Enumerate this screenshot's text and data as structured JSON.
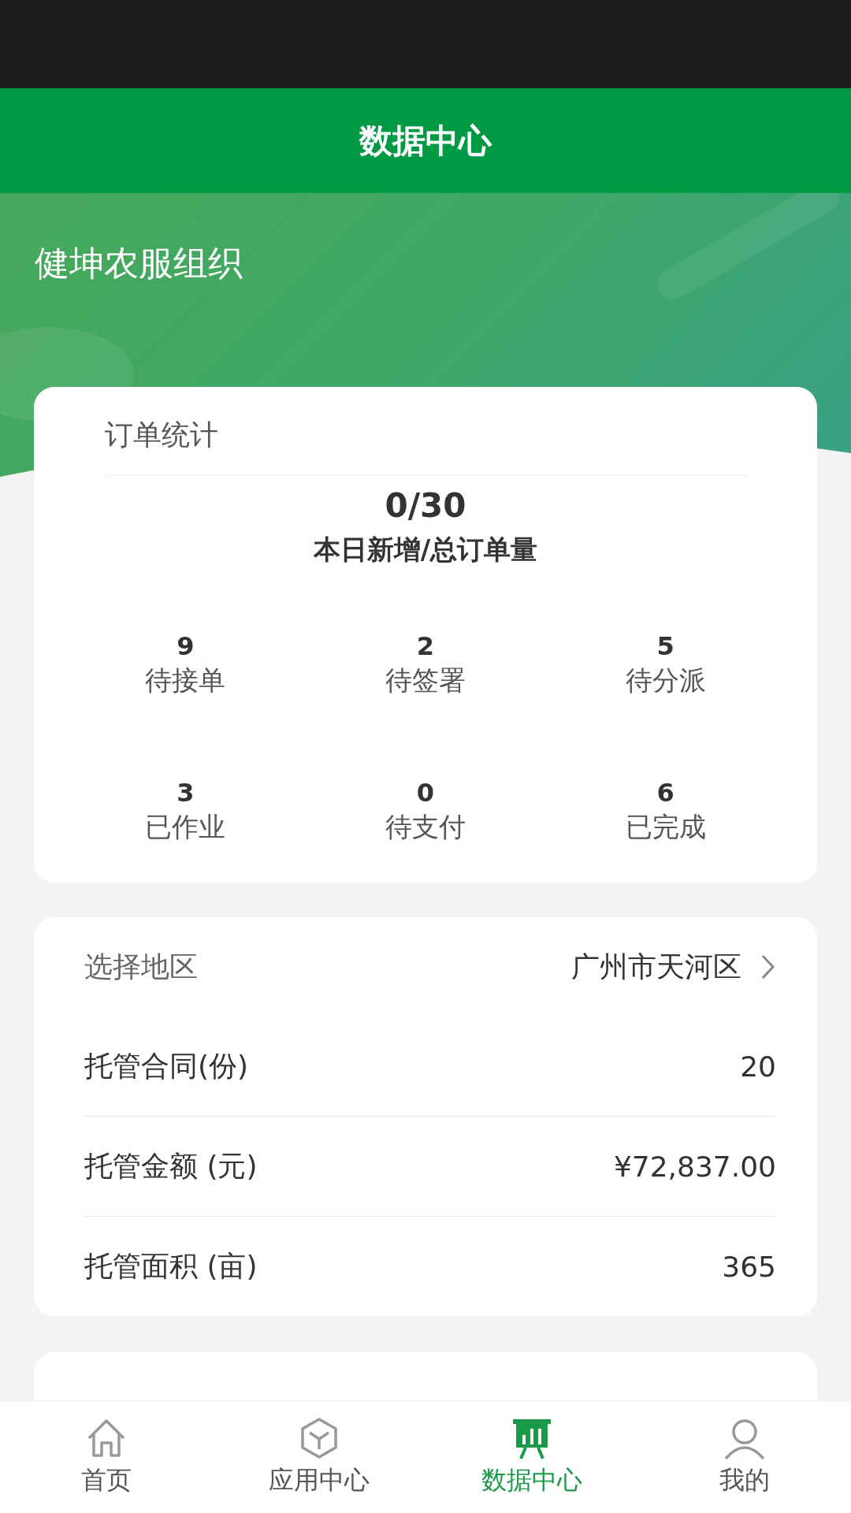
{
  "header": {
    "title": "数据中心"
  },
  "organization": "健坤农服组织",
  "order_stats": {
    "title": "订单统计",
    "total_value": "0/30",
    "total_label": "本日新增/总订单量",
    "items": [
      {
        "value": "9",
        "label": "待接单"
      },
      {
        "value": "2",
        "label": "待签署"
      },
      {
        "value": "5",
        "label": "待分派"
      },
      {
        "value": "3",
        "label": "已作业"
      },
      {
        "value": "0",
        "label": "待支付"
      },
      {
        "value": "6",
        "label": "已完成"
      }
    ]
  },
  "region": {
    "label": "选择地区",
    "value": "广州市天河区"
  },
  "metrics": [
    {
      "label": "托管合同(份)",
      "value": "20"
    },
    {
      "label": "托管金额 (元)",
      "value": "¥72,837.00"
    },
    {
      "label": "托管面积 (亩)",
      "value": "365"
    }
  ],
  "tab_bar": [
    {
      "label": "首页",
      "selected": false
    },
    {
      "label": "应用中心",
      "selected": false
    },
    {
      "label": "数据中心",
      "selected": true
    },
    {
      "label": "我的",
      "selected": false
    }
  ]
}
